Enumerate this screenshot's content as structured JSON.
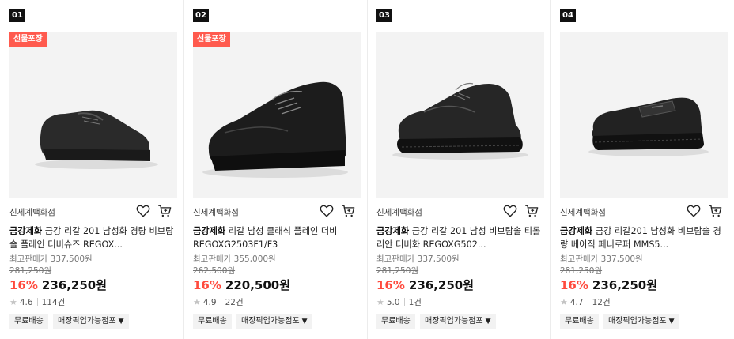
{
  "products": [
    {
      "rank": "01",
      "badge": "선물포장",
      "store": "신세계백화점",
      "brand": "금강제화",
      "title": "금강 리갈 201 남성화 경량 비브람솔 플레인 더비슈즈 REGOX...",
      "max_price": "최고판매가 337,500원",
      "original_price": "281,250원",
      "discount": "16%",
      "price": "236,250원",
      "rating": "4.6",
      "reviews": "114건",
      "tag_delivery": "무료배송",
      "tag_pickup": "매장픽업가능점포",
      "image": "plain-derby-black-shoe"
    },
    {
      "rank": "02",
      "badge": "선물포장",
      "store": "신세계백화점",
      "brand": "금강제화",
      "title": "리갈 남성 클래식 플레인 더비 REGOXG2503F1/F3",
      "max_price": "최고판매가 355,000원",
      "original_price": "262,500원",
      "discount": "16%",
      "price": "220,500원",
      "rating": "4.9",
      "reviews": "22건",
      "tag_delivery": "무료배송",
      "tag_pickup": "매장픽업가능점포",
      "image": "classic-derby-black-shoe"
    },
    {
      "rank": "03",
      "badge": "",
      "store": "신세계백화점",
      "brand": "금강제화",
      "title": "금강 리갈 201 남성 비브람솔 티롤리안 더비화 REGOXG502...",
      "max_price": "최고판매가 337,500원",
      "original_price": "281,250원",
      "discount": "16%",
      "price": "236,250원",
      "rating": "5.0",
      "reviews": "1건",
      "tag_delivery": "무료배송",
      "tag_pickup": "매장픽업가능점포",
      "image": "tyrolean-derby-black-shoe"
    },
    {
      "rank": "04",
      "badge": "",
      "store": "신세계백화점",
      "brand": "금강제화",
      "title": "금강 리갈201 남성화 비브람솔 경량 베이직 페니로퍼 MMS5...",
      "max_price": "최고판매가 337,500원",
      "original_price": "281,250원",
      "discount": "16%",
      "price": "236,250원",
      "rating": "4.7",
      "reviews": "12건",
      "tag_delivery": "무료배송",
      "tag_pickup": "매장픽업가능점포",
      "image": "penny-loafer-black-shoe"
    }
  ],
  "colors": {
    "badge": "#ff5a4e",
    "discount": "#ff4a3d",
    "image_bg": "#f3f3f3"
  },
  "icons": {
    "wishlist": "heart-outline-icon",
    "cart": "shopping-cart-icon",
    "rating": "star-icon",
    "dropdown": "caret-down-icon"
  }
}
